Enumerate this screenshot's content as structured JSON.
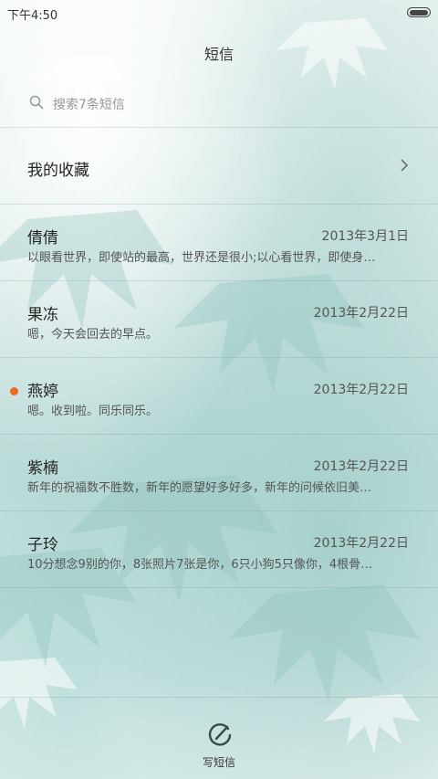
{
  "status": {
    "time": "下午4:50"
  },
  "header": {
    "title": "短信"
  },
  "search": {
    "placeholder": "搜索7条短信"
  },
  "favorites": {
    "label": "我的收藏"
  },
  "conversations": [
    {
      "name": "倩倩",
      "date": "2013年3月1日",
      "preview": "以眼看世界，即使站的最高，世界还是很小;以心看世界，即使身…",
      "unread": false
    },
    {
      "name": "果冻",
      "date": "2013年2月22日",
      "preview": "嗯，今天会回去的早点。",
      "unread": false
    },
    {
      "name": "燕婷",
      "date": "2013年2月22日",
      "preview": "嗯。收到啦。同乐同乐。",
      "unread": true
    },
    {
      "name": "紫楠",
      "date": "2013年2月22日",
      "preview": "新年的祝福数不胜数，新年的愿望好多好多，新年的问候依旧美…",
      "unread": false
    },
    {
      "name": "子玲",
      "date": "2013年2月22日",
      "preview": "10分想念9别的你，8张照片7张是你，6只小狗5只像你，4根骨…",
      "unread": false
    }
  ],
  "compose": {
    "label": "写短信"
  },
  "colors": {
    "unread_dot": "#f26b1d",
    "accent": "#3a4a4a"
  }
}
